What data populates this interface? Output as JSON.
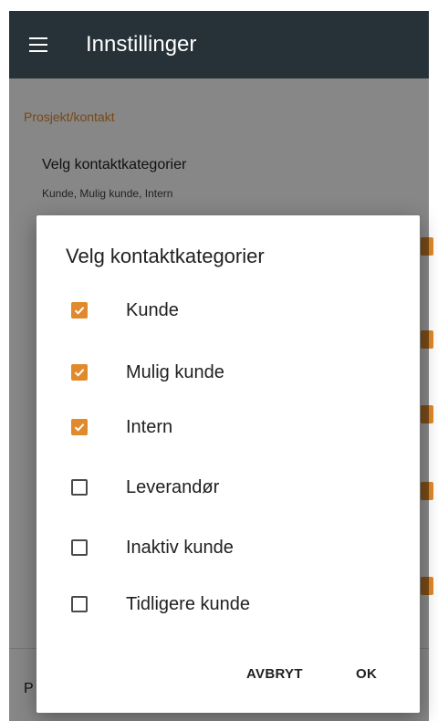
{
  "appbar": {
    "title": "Innstillinger",
    "menu_icon": "hamburger-menu-icon"
  },
  "settings": {
    "section_header": "Prosjekt/kontakt",
    "pref_title": "Velg kontaktkategorier",
    "pref_summary": "Kunde, Mulig kunde, Intern",
    "peek_letter": "P"
  },
  "dialog": {
    "title": "Velg kontaktkategorier",
    "options": [
      {
        "label": "Kunde",
        "checked": true
      },
      {
        "label": "Mulig kunde",
        "checked": true
      },
      {
        "label": "Intern",
        "checked": true
      },
      {
        "label": "Leverandør",
        "checked": false
      },
      {
        "label": "Inaktiv kunde",
        "checked": false
      },
      {
        "label": "Tidligere kunde",
        "checked": false
      }
    ],
    "cancel_label": "AVBRYT",
    "ok_label": "OK"
  },
  "colors": {
    "accent": "#e08a2b",
    "appbar": "#263238"
  }
}
